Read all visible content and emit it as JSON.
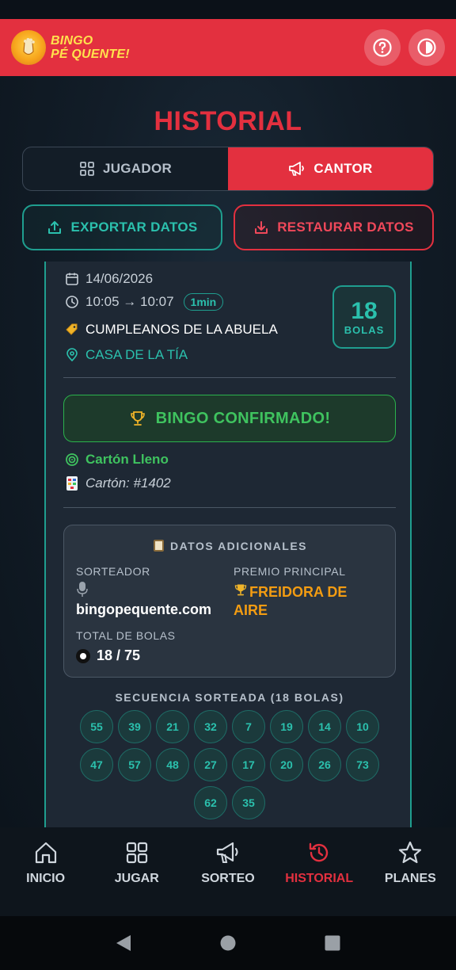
{
  "app": {
    "brand_line1": "BINGO",
    "brand_line2": "PÉ QUENTE!"
  },
  "colors": {
    "primary": "#e3303f",
    "teal": "#2bc0ad",
    "green": "#3fc35f",
    "orange": "#f39c12"
  },
  "page": {
    "title": "HISTORIAL"
  },
  "tabs": [
    {
      "label": "JUGADOR",
      "icon": "grid-icon",
      "active": false
    },
    {
      "label": "CANTOR",
      "icon": "megaphone-icon",
      "active": true
    }
  ],
  "actions": {
    "export_label": "EXPORTAR DATOS",
    "restore_label": "RESTAURAR DATOS"
  },
  "game": {
    "date": "14/06/2026",
    "time_range": "10:05 → 10:07",
    "duration": "1min",
    "event_name": "CUMPLEANOS DE LA ABUELA",
    "location": "CASA DE LA TÍA",
    "balls_count": "18",
    "balls_label": "BOLAS",
    "result": "BINGO CONFIRMADO!",
    "pattern": "Cartón Lleno",
    "card": "Cartón: #1402"
  },
  "extra": {
    "title": "DATOS ADICIONALES",
    "drawer_label": "SORTEADOR",
    "drawer_value": "bingopequente.com",
    "prize_label": "PREMIO PRINCIPAL",
    "prize_value": "FREIDORA DE AIRE",
    "total_label": "TOTAL DE BOLAS",
    "total_value": "18 / 75"
  },
  "sequence": {
    "title": "SECUENCIA SORTEADA (18 BOLAS)",
    "balls": [
      "55",
      "39",
      "21",
      "32",
      "7",
      "19",
      "14",
      "10",
      "47",
      "57",
      "48",
      "27",
      "17",
      "20",
      "26",
      "73",
      "62",
      "35"
    ]
  },
  "nav": [
    {
      "label": "INICIO",
      "icon": "home-icon",
      "active": false
    },
    {
      "label": "JUGAR",
      "icon": "grid-icon",
      "active": false
    },
    {
      "label": "SORTEO",
      "icon": "megaphone-icon",
      "active": false
    },
    {
      "label": "HISTORIAL",
      "icon": "history-icon",
      "active": true
    },
    {
      "label": "PLANES",
      "icon": "star-icon",
      "active": false
    }
  ]
}
